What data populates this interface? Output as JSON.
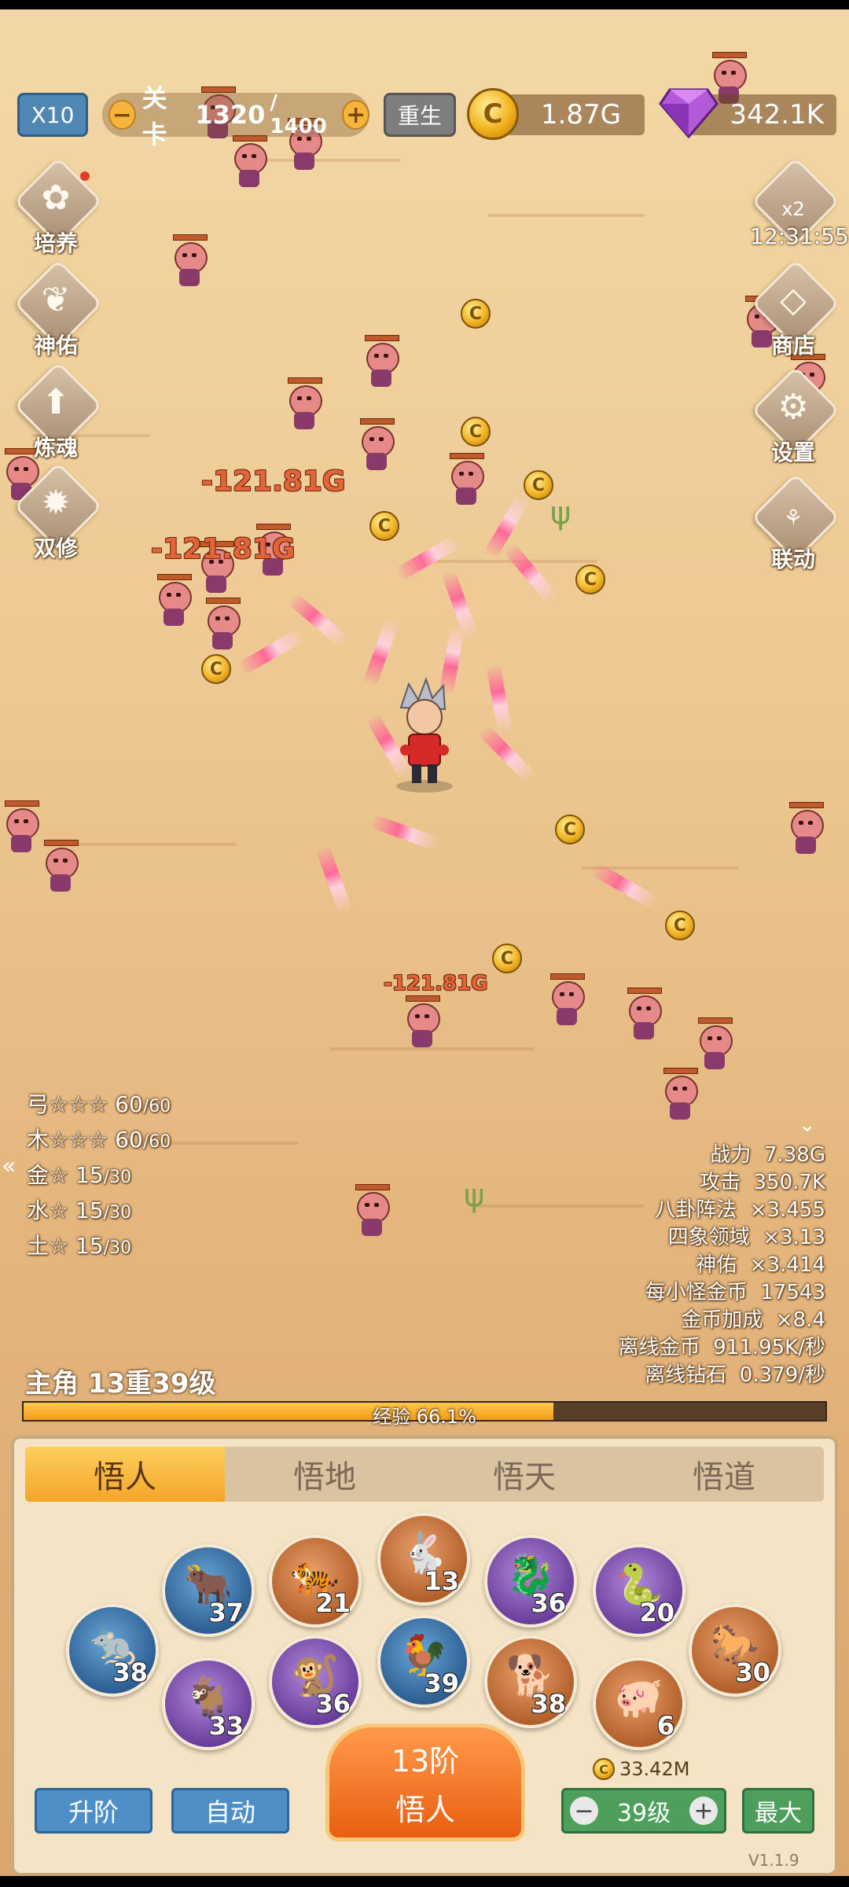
{
  "hud": {
    "multiplier_label": "X10",
    "stage_label": "关卡",
    "stage_current": "1320",
    "stage_total": "/ 1400",
    "minus": "−",
    "plus": "+",
    "rebirth_label": "重生",
    "gold_value": "1.87G",
    "gem_value": "342.1K"
  },
  "left_menu": [
    {
      "label": "培养",
      "icon": "sprout-icon"
    },
    {
      "label": "神佑",
      "icon": "wings-icon"
    },
    {
      "label": "炼魂",
      "icon": "upgrade-arrow-icon"
    },
    {
      "label": "双修",
      "icon": "flame-icon"
    }
  ],
  "right_menu": {
    "bonus_badge": "x2",
    "bonus_timer": "12:31:55",
    "shop_label": "商店",
    "settings_label": "设置",
    "link_label": "联动"
  },
  "damage_texts": [
    "-121.81G",
    "-121.81G",
    "-121.81G"
  ],
  "coin_symbol": "C",
  "left_stats": [
    {
      "name": "弓",
      "stars": "☆☆☆",
      "value": "60",
      "max": "/60"
    },
    {
      "name": "木",
      "stars": "☆☆☆",
      "value": "60",
      "max": "/60"
    },
    {
      "name": "金",
      "stars": "☆",
      "value": "15",
      "max": "/30"
    },
    {
      "name": "水",
      "stars": "☆",
      "value": "15",
      "max": "/30"
    },
    {
      "name": "土",
      "stars": "☆",
      "value": "15",
      "max": "/30"
    }
  ],
  "right_stats": [
    {
      "name": "战力",
      "value": "7.38G"
    },
    {
      "name": "攻击",
      "value": "350.7K"
    },
    {
      "name": "八卦阵法",
      "value": "×3.455"
    },
    {
      "name": "四象领域",
      "value": "×3.13"
    },
    {
      "name": "神佑",
      "value": "×3.414"
    },
    {
      "name": "每小怪金币",
      "value": "17543"
    },
    {
      "name": "金币加成",
      "value": "×8.4"
    },
    {
      "name": "离线金币",
      "value": "911.95K/秒"
    },
    {
      "name": "离线钻石",
      "value": "0.379/秒"
    }
  ],
  "hero": {
    "level_text": "主角 13重39级",
    "exp_label": "经验 66.1%",
    "exp_fraction": 0.661
  },
  "tabs": [
    "悟人",
    "悟地",
    "悟天",
    "悟道"
  ],
  "zodiac": [
    {
      "animal": "rat",
      "glyph": "🐀",
      "level": "38",
      "color": "blue"
    },
    {
      "animal": "ox",
      "glyph": "🐂",
      "level": "37",
      "color": "blue"
    },
    {
      "animal": "goat",
      "glyph": "🐐",
      "level": "33",
      "color": "purple"
    },
    {
      "animal": "tiger",
      "glyph": "🐅",
      "level": "21",
      "color": "orange"
    },
    {
      "animal": "monkey",
      "glyph": "🐒",
      "level": "36",
      "color": "purple"
    },
    {
      "animal": "rabbit",
      "glyph": "🐇",
      "level": "13",
      "color": "orange"
    },
    {
      "animal": "rooster",
      "glyph": "🐓",
      "level": "39",
      "color": "blue"
    },
    {
      "animal": "dragon",
      "glyph": "🐉",
      "level": "36",
      "color": "purple"
    },
    {
      "animal": "dog",
      "glyph": "🐕",
      "level": "38",
      "color": "orange"
    },
    {
      "animal": "snake",
      "glyph": "🐍",
      "level": "20",
      "color": "purple"
    },
    {
      "animal": "pig",
      "glyph": "🐖",
      "level": "6",
      "color": "orange"
    },
    {
      "animal": "horse",
      "glyph": "🐎",
      "level": "30",
      "color": "orange"
    }
  ],
  "bottom": {
    "advance_label": "升阶",
    "auto_label": "自动",
    "stage_rank": "13阶",
    "stage_name": "悟人",
    "cost": "33.42M",
    "level_value": "39级",
    "minus": "−",
    "plus": "+",
    "max_label": "最大",
    "version": "V1.1.9"
  },
  "colors": {
    "accent_orange": "#f3a52a",
    "button_blue": "#4f8fc8",
    "button_green": "#4f9f5c",
    "damage": "#e4643a"
  }
}
